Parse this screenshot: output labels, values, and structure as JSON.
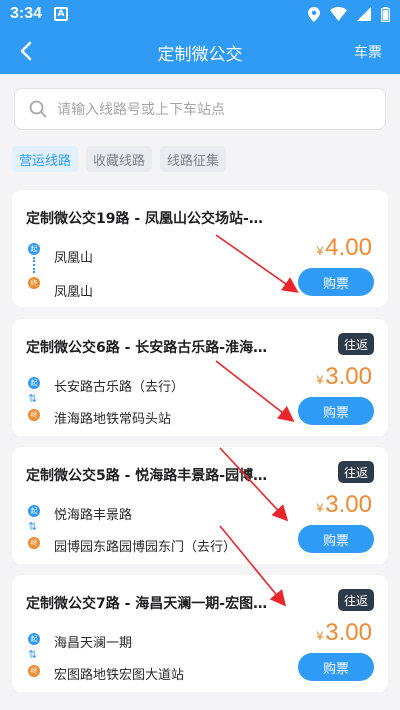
{
  "status": {
    "time": "3:34",
    "app_icon_letter": "A"
  },
  "nav": {
    "title": "定制微公交",
    "right_label": "车票"
  },
  "search": {
    "placeholder": "请输入线路号或上下车站点"
  },
  "tabs": [
    {
      "label": "营运线路",
      "active": true
    },
    {
      "label": "收藏线路",
      "active": false
    },
    {
      "label": "线路征集",
      "active": false
    }
  ],
  "routes": [
    {
      "name": "定制微公交19路 - 凤凰山公交场站-…",
      "badge": "",
      "start": "凤凰山",
      "end": "凤凰山",
      "price": "4.00",
      "currency": "¥",
      "buy": "购票",
      "start_mark": "起",
      "end_mark": "终"
    },
    {
      "name": "定制微公交6路 - 长安路古乐路-淮海…",
      "badge": "往返",
      "start": "长安路古乐路（去行）",
      "end": "淮海路地铁常码头站",
      "price": "3.00",
      "currency": "¥",
      "buy": "购票",
      "start_mark": "起",
      "end_mark": "终"
    },
    {
      "name": "定制微公交5路 - 悦海路丰景路-园博…",
      "badge": "往返",
      "start": "悦海路丰景路",
      "end": "园博园东路园博园东门（去行）",
      "price": "3.00",
      "currency": "¥",
      "buy": "购票",
      "start_mark": "起",
      "end_mark": "终"
    },
    {
      "name": "定制微公交7路 - 海昌天澜一期-宏图…",
      "badge": "往返",
      "start": "海昌天澜一期",
      "end": "宏图路地铁宏图大道站",
      "price": "3.00",
      "currency": "¥",
      "buy": "购票",
      "start_mark": "起",
      "end_mark": "终"
    }
  ],
  "colors": {
    "primary": "#2f9bf5",
    "accent": "#f08a2e",
    "annotation": "#e8262b"
  }
}
